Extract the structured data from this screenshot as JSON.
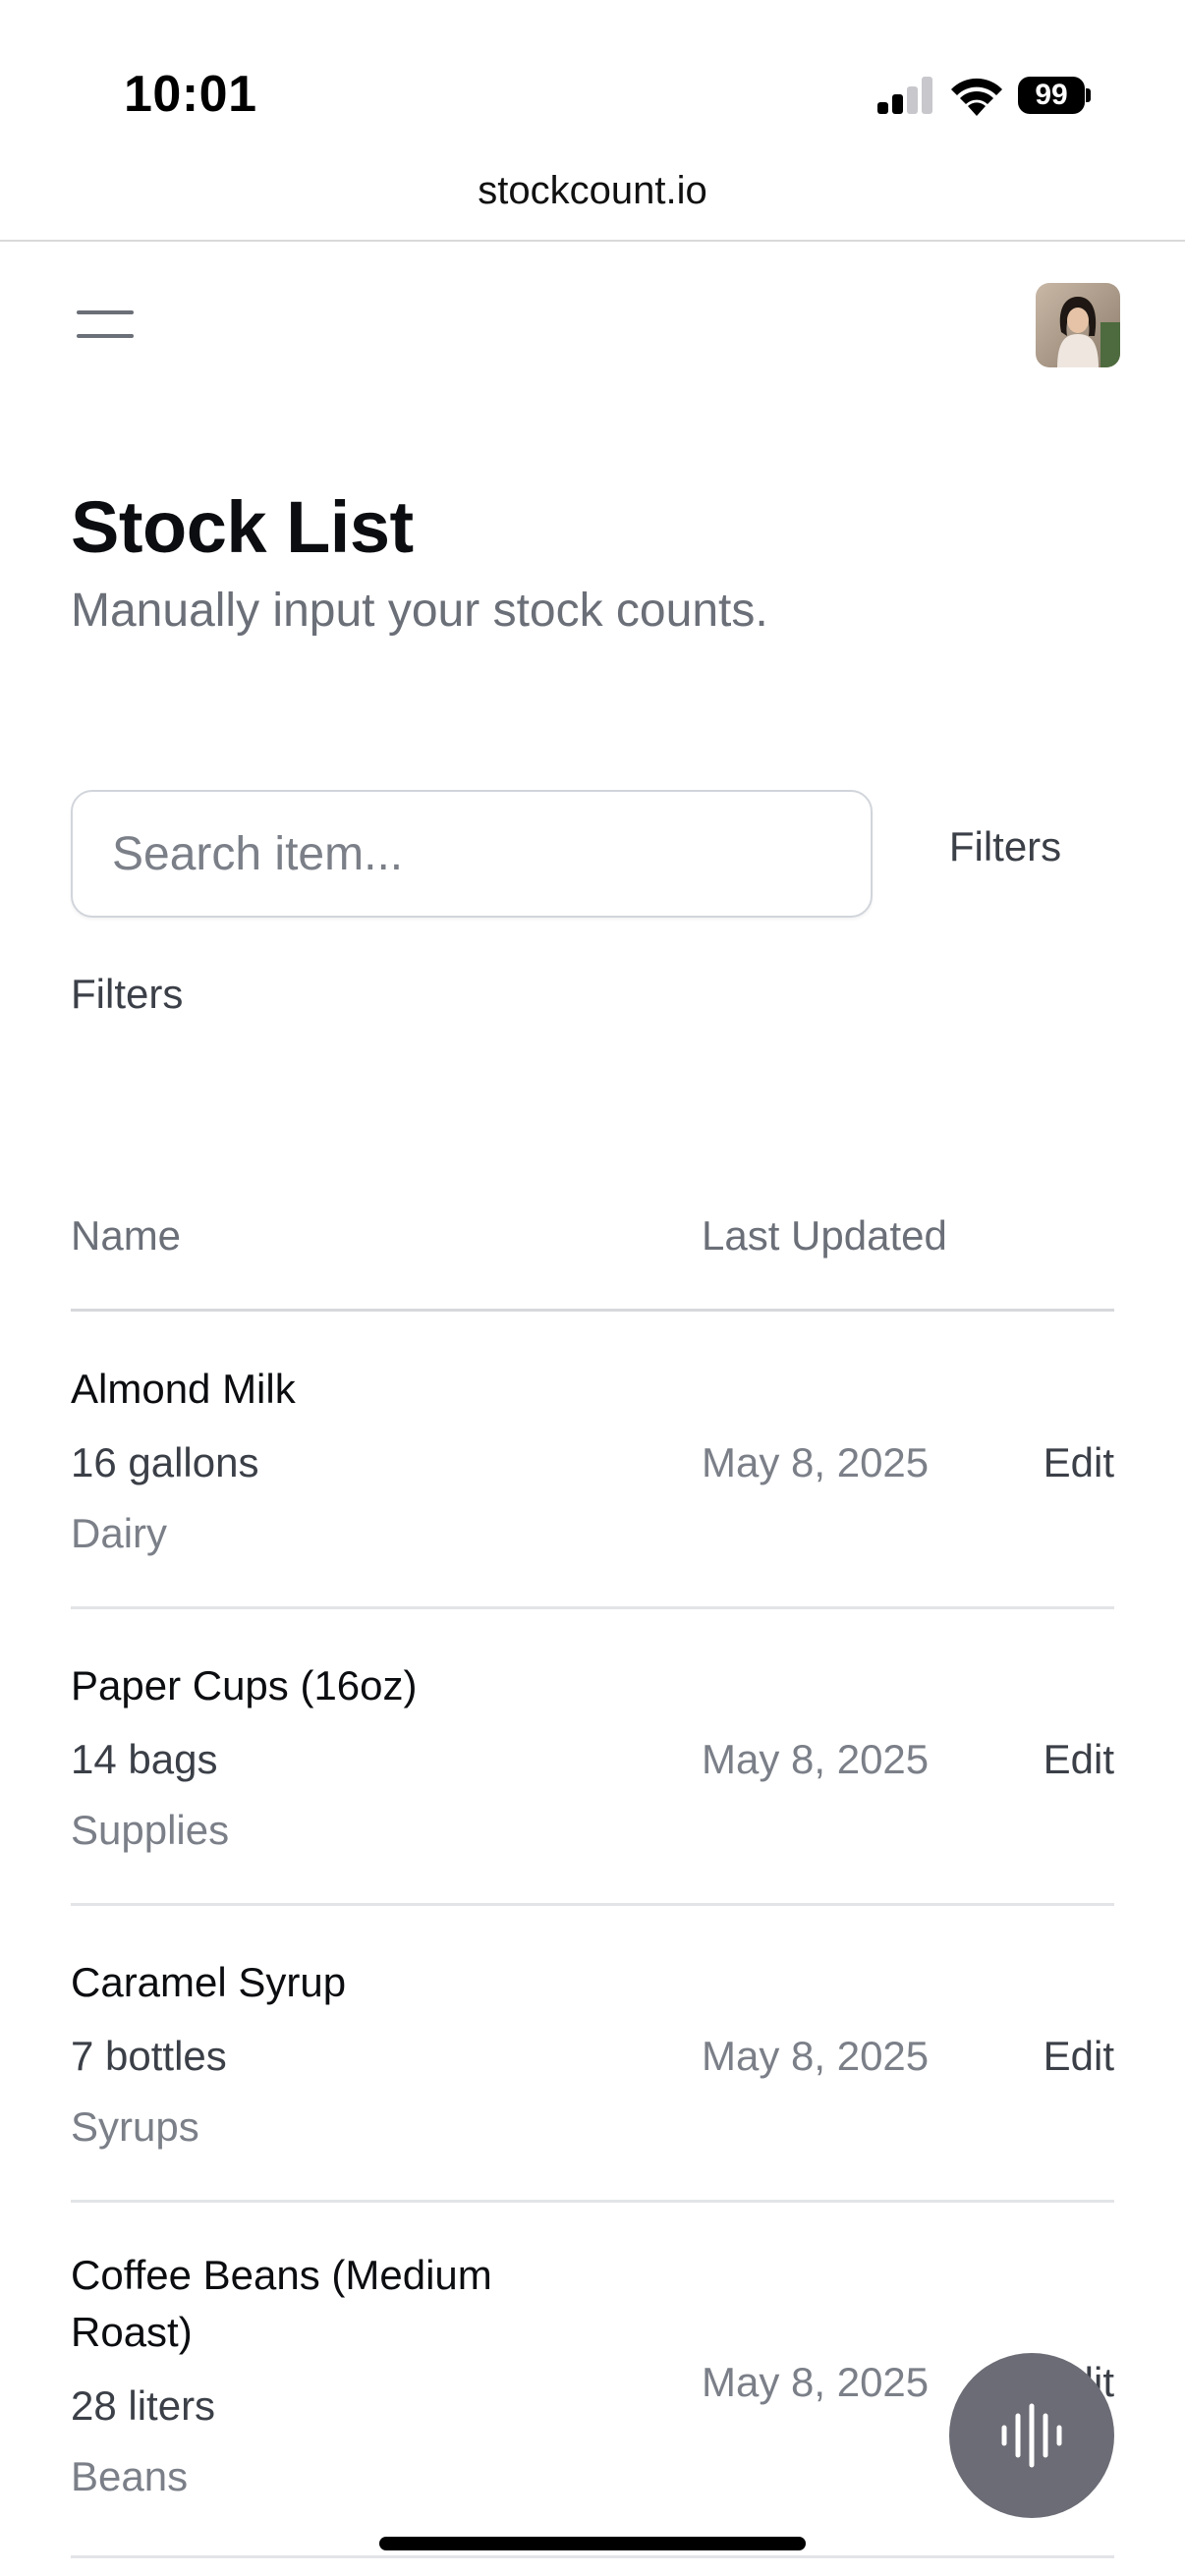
{
  "status_bar": {
    "time": "10:01",
    "battery": "99",
    "signal_bars_active": 2,
    "signal_bars_total": 4
  },
  "browser": {
    "url": "stockcount.io"
  },
  "header": {
    "menu_icon": "hamburger-menu-icon",
    "avatar": "user-avatar"
  },
  "page": {
    "title": "Stock List",
    "subtitle": "Manually input your stock counts."
  },
  "search": {
    "placeholder": "Search item...",
    "value": "",
    "filters_button": "Filters"
  },
  "filters_label": "Filters",
  "table": {
    "columns": {
      "name": "Name",
      "last_updated": "Last Updated"
    },
    "rows": [
      {
        "name": "Almond Milk",
        "quantity": "16 gallons",
        "category": "Dairy",
        "last_updated": "May 8, 2025",
        "action": "Edit"
      },
      {
        "name": "Paper Cups (16oz)",
        "quantity": "14 bags",
        "category": "Supplies",
        "last_updated": "May 8, 2025",
        "action": "Edit"
      },
      {
        "name": "Caramel Syrup",
        "quantity": "7 bottles",
        "category": "Syrups",
        "last_updated": "May 8, 2025",
        "action": "Edit"
      },
      {
        "name": "Coffee Beans (Medium Roast)",
        "quantity": "28 liters",
        "category": "Beans",
        "last_updated": "May 8, 2025",
        "action": "Edit"
      }
    ]
  },
  "fab": {
    "icon": "voice-waveform-icon"
  },
  "colors": {
    "text_primary": "#0b0d10",
    "text_secondary": "#6b6f78",
    "border": "#d6d8dc",
    "fab_background": "#6b6c75"
  }
}
